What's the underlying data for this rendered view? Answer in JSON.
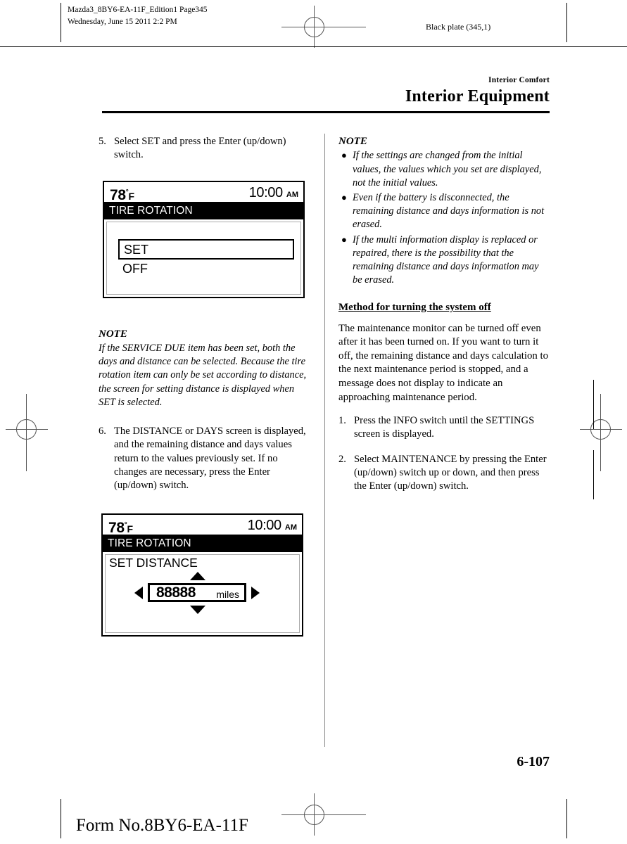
{
  "header": {
    "doc_line1": "Mazda3_8BY6-EA-11F_Edition1 Page345",
    "doc_line2": "Wednesday, June 15 2011 2:2 PM",
    "black_plate": "Black plate (345,1)"
  },
  "section": {
    "eyebrow": "Interior Comfort",
    "title": "Interior Equipment"
  },
  "left_column": {
    "step5": {
      "number": "5.",
      "text": "Select SET and press the Enter (up/down) switch."
    },
    "screen1": {
      "temperature": "78",
      "degree": "°",
      "unit": "F",
      "time": "10:00",
      "ampm": "AM",
      "title": "TIRE ROTATION",
      "selected_item": "SET",
      "second_item": "OFF"
    },
    "note": {
      "heading": "NOTE",
      "body": "If the SERVICE DUE item has been set, both the days and distance can be selected. Because the tire rotation item can only be set according to distance, the screen for setting distance is displayed when SET is selected."
    },
    "step6": {
      "number": "6.",
      "text": "The DISTANCE or DAYS screen is displayed, and the remaining distance and days values return to the values previously set. If no changes are necessary, press the Enter (up/down) switch."
    },
    "screen2": {
      "temperature": "78",
      "degree": "°",
      "unit": "F",
      "time": "10:00",
      "ampm": "AM",
      "title": "TIRE ROTATION",
      "label": "SET DISTANCE",
      "value": "88888",
      "value_unit": "miles",
      "arrow_left": "left-arrow-icon",
      "arrow_right": "right-arrow-icon",
      "arrow_up": "up-arrow-icon",
      "arrow_down": "down-arrow-icon"
    }
  },
  "right_column": {
    "note": {
      "heading": "NOTE",
      "items": [
        "If the settings are changed from the initial values, the values which you set are displayed, not the initial values.",
        "Even if the battery is disconnected, the remaining distance and days information is not erased.",
        "If the multi information display is replaced or repaired, there is the possibility that the remaining distance and days information may be erased."
      ]
    },
    "subheading": "Method for turning the system off",
    "paragraph": "The maintenance monitor can be turned off even after it has been turned on. If you want to turn it off, the remaining distance and days calculation to the next maintenance period is stopped, and a message does not display to indicate an approaching maintenance period.",
    "step1": {
      "number": "1.",
      "text": "Press the INFO switch until the SETTINGS screen is displayed."
    },
    "step2": {
      "number": "2.",
      "text": "Select MAINTENANCE by pressing the Enter (up/down) switch up or down, and then press the Enter (up/down) switch."
    }
  },
  "footer": {
    "page_number": "6-107",
    "form_number": "Form No.8BY6-EA-11F"
  }
}
